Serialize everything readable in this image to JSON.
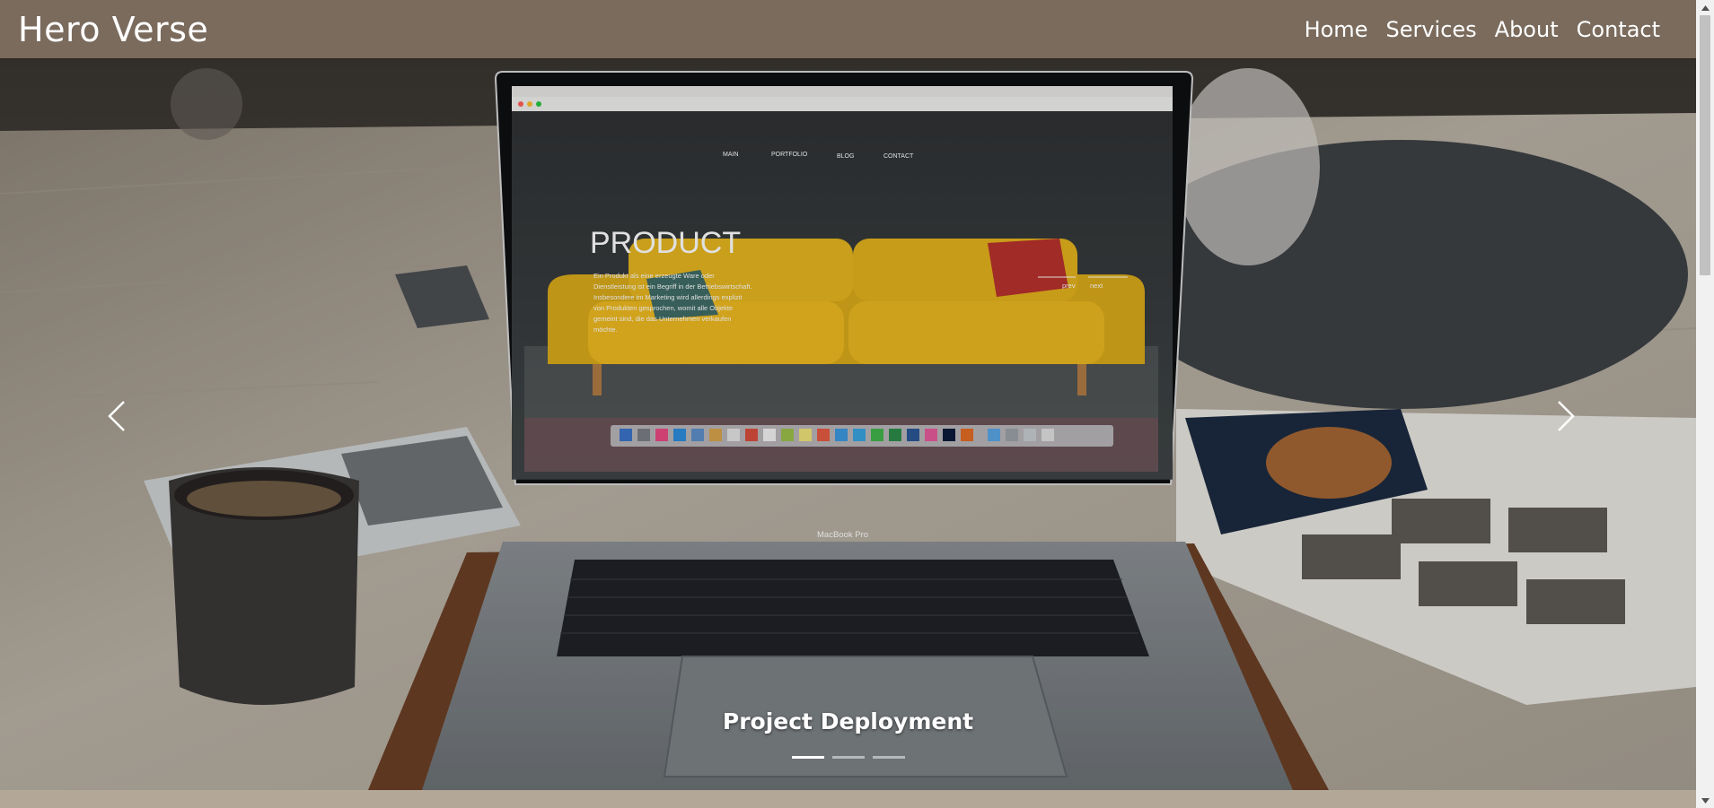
{
  "brand": "Hero Verse",
  "nav": {
    "home": "Home",
    "services": "Services",
    "about": "About",
    "contact": "Contact"
  },
  "carousel": {
    "caption": "Project Deployment",
    "active_index": 0,
    "slide_count": 3
  },
  "laptop_screen": {
    "menu": {
      "main": "MAIN",
      "portfolio": "PORTFOLIO",
      "blog": "BLOG",
      "contact": "CONTACT"
    },
    "headline": "PRODUCT",
    "body": [
      "Ein Produkt als eine erzeugte Ware oder",
      "Dienstleistung ist ein Begriff in der Betriebswirtschaft.",
      "Insbesondere im Marketing wird allerdings explizit",
      "von Produkten gesprochen, womit alle Objekte",
      "gemeint sind, die das Unternehmen verkaufen",
      "möchte."
    ],
    "prev": "prev",
    "next": "next",
    "model": "MacBook Pro"
  },
  "colors": {
    "navbar": "#7a6b5d",
    "page_bg": "#b3a897"
  }
}
